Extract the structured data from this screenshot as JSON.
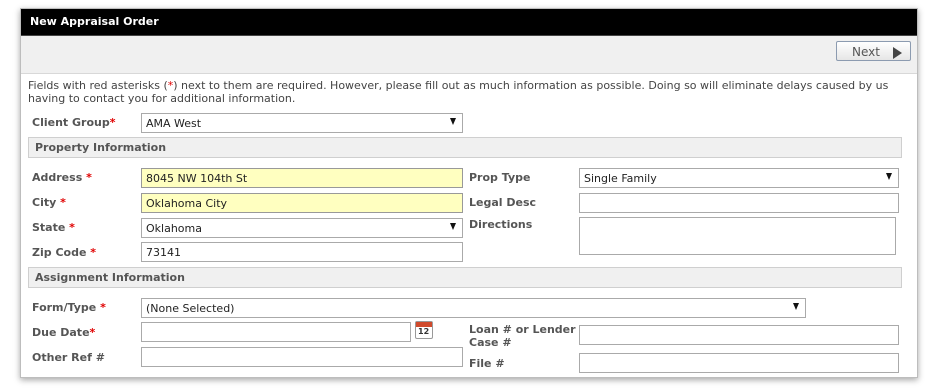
{
  "window": {
    "title": "New Appraisal Order"
  },
  "toolbar": {
    "next_label": "Next"
  },
  "info": {
    "text_before": "Fields with red asterisks (",
    "asterisk": "*",
    "text_after": ") next to them are required. However, please fill out as much information as possible. Doing so will eliminate delays caused by us having to contact you for additional information."
  },
  "client_group": {
    "label": "Client Group",
    "value": "AMA West"
  },
  "property": {
    "heading": "Property Information",
    "address": {
      "label": "Address",
      "value": "8045 NW 104th St"
    },
    "city": {
      "label": "City",
      "value": "Oklahoma City"
    },
    "state": {
      "label": "State",
      "value": "Oklahoma"
    },
    "zip": {
      "label": "Zip Code",
      "value": "73141"
    },
    "prop_type": {
      "label": "Prop Type",
      "value": "Single Family"
    },
    "legal_desc": {
      "label": "Legal Desc",
      "value": ""
    },
    "directions": {
      "label": "Directions",
      "value": ""
    }
  },
  "assignment": {
    "heading": "Assignment Information",
    "form_type": {
      "label": "Form/Type",
      "value": "(None Selected)"
    },
    "due_date": {
      "label": "Due Date",
      "value": "",
      "calendar_day": "12"
    },
    "other_ref": {
      "label": "Other Ref #",
      "value": ""
    },
    "loan": {
      "label_line1": "Loan # or Lender",
      "label_line2": "Case #",
      "value": ""
    },
    "file": {
      "label": "File #",
      "value": ""
    }
  },
  "required_mark": "*"
}
